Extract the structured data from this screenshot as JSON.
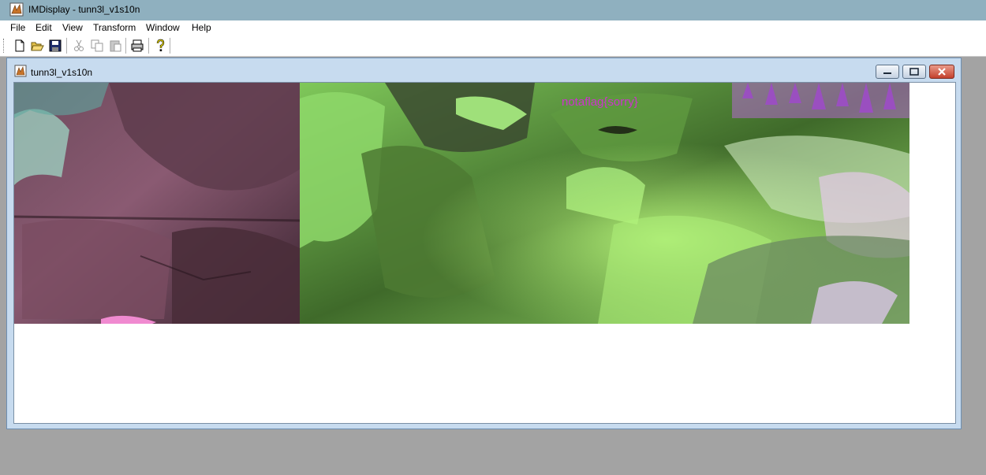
{
  "app": {
    "title": "IMDisplay - tunn3l_v1s10n"
  },
  "menu": {
    "items": [
      "File",
      "Edit",
      "View",
      "Transform",
      "Window",
      "Help"
    ]
  },
  "toolbar": {
    "buttons": [
      "new-file-icon",
      "open-folder-icon",
      "save-icon",
      "cut-icon",
      "copy-icon",
      "paste-icon",
      "print-icon",
      "help-icon"
    ]
  },
  "child_window": {
    "title": "tunn3l_v1s10n"
  },
  "image": {
    "overlay_text": "notaflag{sorry}"
  },
  "colors": {
    "titlebar": "#8fb0bf",
    "child_frame": "#c7dbef",
    "overlay_text": "#cc33cc",
    "close_button": "#c4412d"
  }
}
